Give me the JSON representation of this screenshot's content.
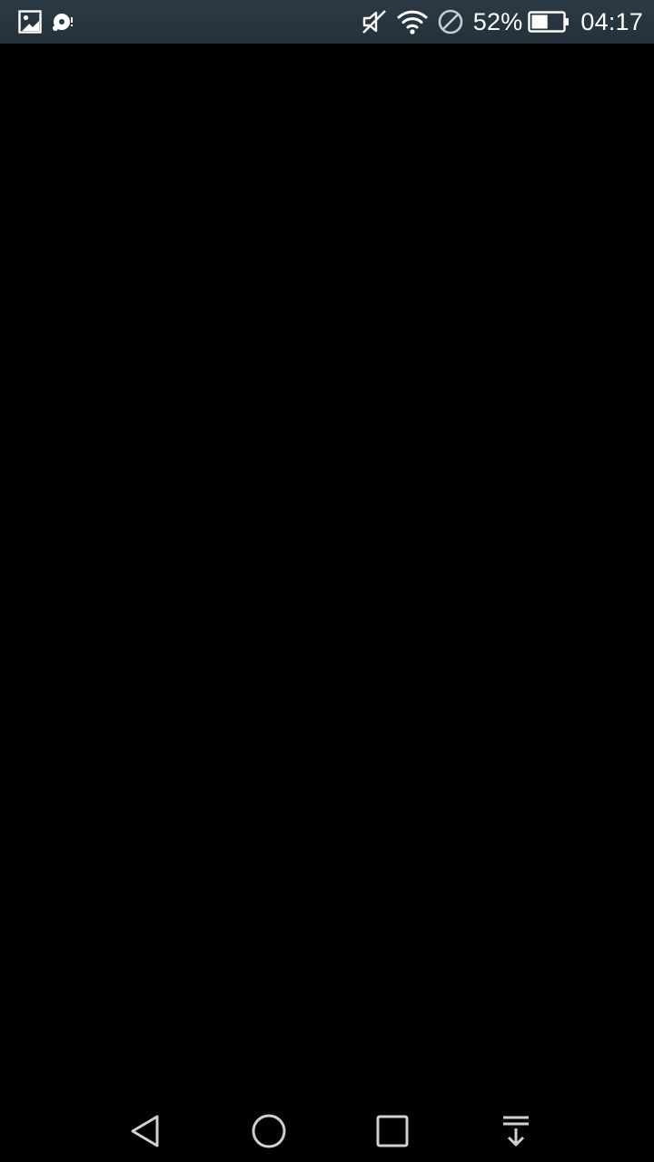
{
  "status_bar": {
    "battery_percent": "52%",
    "battery_level": 0.52,
    "time": "04:17",
    "icons": [
      "gallery-icon",
      "screen-record-icon",
      "mute-icon",
      "wifi-icon",
      "do-not-disturb-icon",
      "battery-icon"
    ]
  },
  "navigation_bar": {
    "buttons": [
      "back-button",
      "home-button",
      "recents-button",
      "notification-pull-down-button"
    ]
  },
  "colors": {
    "background": "#000000",
    "status_bar": "#2b3a45",
    "icon": "#ffffff",
    "nav_icon": "#d0d0d0"
  }
}
